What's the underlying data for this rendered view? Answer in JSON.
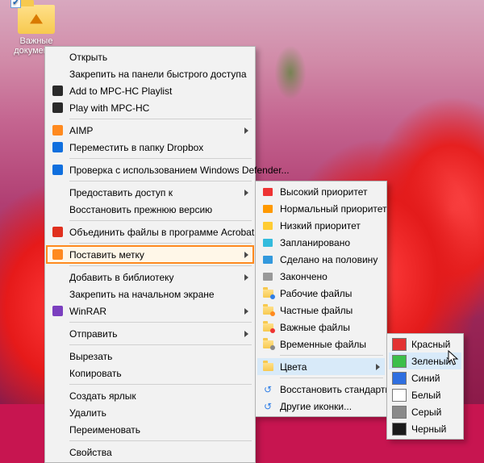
{
  "desktop": {
    "icon_label": "Важные документы"
  },
  "menu_main": [
    {
      "label": "Открыть",
      "icon": null,
      "sub": false
    },
    {
      "label": "Закрепить на панели быстрого доступа",
      "icon": null,
      "sub": false
    },
    {
      "label": "Add to MPC-HC Playlist",
      "icon": "mpc",
      "sub": false
    },
    {
      "label": "Play with MPC-HC",
      "icon": "mpc",
      "sub": false
    },
    {
      "sep": true
    },
    {
      "label": "AIMP",
      "icon": "aimp",
      "sub": true
    },
    {
      "label": "Переместить в папку Dropbox",
      "icon": "dropbox",
      "sub": false
    },
    {
      "sep": true
    },
    {
      "label": "Проверка с использованием Windows Defender...",
      "icon": "defender",
      "sub": false
    },
    {
      "sep": true
    },
    {
      "label": "Предоставить доступ к",
      "icon": null,
      "sub": true
    },
    {
      "label": "Восстановить прежнюю версию",
      "icon": null,
      "sub": false
    },
    {
      "sep": true
    },
    {
      "label": "Объединить файлы в программе Acrobat...",
      "icon": "acrobat",
      "sub": false
    },
    {
      "sep": true
    },
    {
      "label": "Поставить метку",
      "icon": "tag",
      "sub": true,
      "highlight": true
    },
    {
      "sep": true
    },
    {
      "label": "Добавить в библиотеку",
      "icon": null,
      "sub": true
    },
    {
      "label": "Закрепить на начальном экране",
      "icon": null,
      "sub": false
    },
    {
      "label": "WinRAR",
      "icon": "winrar",
      "sub": true
    },
    {
      "sep": true
    },
    {
      "label": "Отправить",
      "icon": null,
      "sub": true
    },
    {
      "sep": true
    },
    {
      "label": "Вырезать",
      "icon": null,
      "sub": false
    },
    {
      "label": "Копировать",
      "icon": null,
      "sub": false
    },
    {
      "sep": true
    },
    {
      "label": "Создать ярлык",
      "icon": null,
      "sub": false
    },
    {
      "label": "Удалить",
      "icon": null,
      "sub": false
    },
    {
      "label": "Переименовать",
      "icon": null,
      "sub": false
    },
    {
      "sep": true
    },
    {
      "label": "Свойства",
      "icon": null,
      "sub": false
    }
  ],
  "menu_tag": [
    {
      "label": "Высокий приоритет",
      "icon": "flag-red"
    },
    {
      "label": "Нормальный приоритет",
      "icon": "flag-orange"
    },
    {
      "label": "Низкий приоритет",
      "icon": "flag-yellow"
    },
    {
      "label": "Запланировано",
      "icon": "flag-cyan"
    },
    {
      "label": "Сделано на половину",
      "icon": "flag-blue"
    },
    {
      "label": "Закончено",
      "icon": "flag-grey"
    },
    {
      "label": "Рабочие файлы",
      "icon": "fold-blue"
    },
    {
      "label": "Частные файлы",
      "icon": "fold-orange"
    },
    {
      "label": "Важные файлы",
      "icon": "fold-red"
    },
    {
      "label": "Временные файлы",
      "icon": "fold-grey"
    },
    {
      "sep": true
    },
    {
      "label": "Цвета",
      "icon": "fold-plain",
      "sub": true,
      "hover": true
    },
    {
      "sep": true
    },
    {
      "label": "Восстановить стандартную",
      "icon": "restore"
    },
    {
      "label": "Другие иконки...",
      "icon": "restore"
    }
  ],
  "menu_colors": [
    {
      "label": "Красный",
      "swatch": "#e33333"
    },
    {
      "label": "Зеленый",
      "swatch": "#3bbf4a",
      "hover": true
    },
    {
      "label": "Синий",
      "swatch": "#2f6fe0"
    },
    {
      "label": "Белый",
      "swatch": "#ffffff"
    },
    {
      "label": "Серый",
      "swatch": "#8a8a8a"
    },
    {
      "label": "Черный",
      "swatch": "#1a1a1a"
    }
  ]
}
